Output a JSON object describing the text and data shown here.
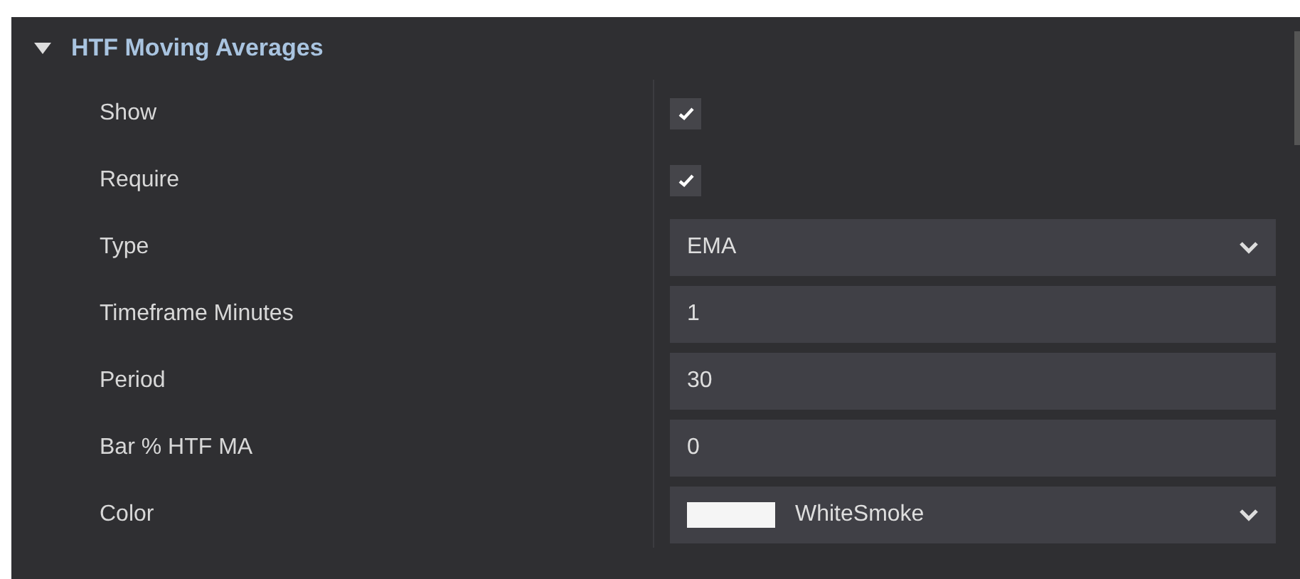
{
  "section": {
    "title": "HTF Moving Averages",
    "expanded": true
  },
  "rows": [
    {
      "label": "Show",
      "kind": "checkbox",
      "checked": true
    },
    {
      "label": "Require",
      "kind": "checkbox",
      "checked": true
    },
    {
      "label": "Type",
      "kind": "dropdown",
      "value": "EMA"
    },
    {
      "label": "Timeframe Minutes",
      "kind": "text",
      "value": "1"
    },
    {
      "label": "Period",
      "kind": "text",
      "value": "30"
    },
    {
      "label": "Bar % HTF MA",
      "kind": "text",
      "value": "0"
    },
    {
      "label": "Color",
      "kind": "color",
      "value": "WhiteSmoke",
      "color": "#f5f5f5"
    }
  ]
}
